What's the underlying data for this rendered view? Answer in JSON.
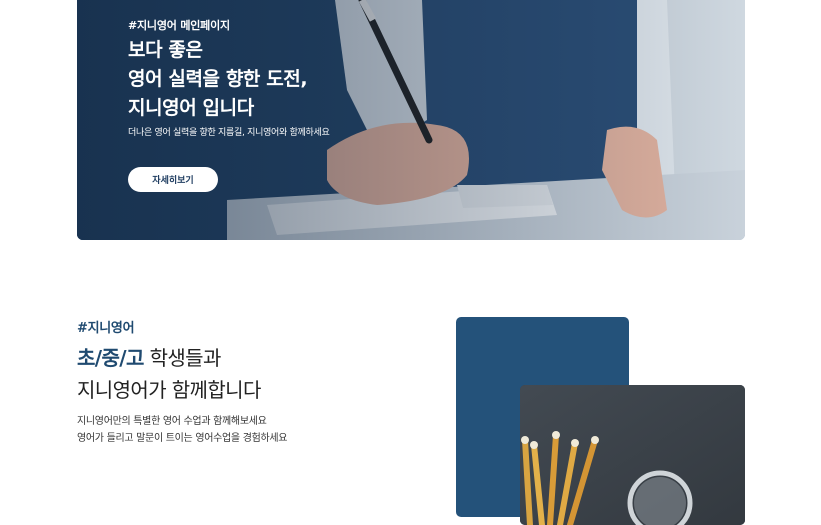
{
  "hero": {
    "tag": "#지니영어 메인페이지",
    "title_lines": [
      "보다 좋은",
      "영어 실력을 향한 도전,",
      "지니영어 입니다"
    ],
    "subtitle": "더나은 영어 실력을 향한 지름길, 지니영어와 함께하세요",
    "button_label": "자세히보기",
    "image": "student-writing-at-laptop-photo"
  },
  "intro": {
    "tag": "#지니영어",
    "title_accent": "초/중/고",
    "title_rest": " 학생들과",
    "title_line2": "지니영어가 함께합니다",
    "desc_lines": [
      "지니영어만의 특별한 영어 수업과 함께해보세요",
      "영어가 들리고 말문이 트이는 영어수업을 경험하세요"
    ],
    "image": "pencils-and-magnifier-on-chalkboard-photo"
  },
  "colors": {
    "primary": "#1f4a70",
    "navy_block": "#24527a",
    "button_text": "#1e3c60"
  }
}
